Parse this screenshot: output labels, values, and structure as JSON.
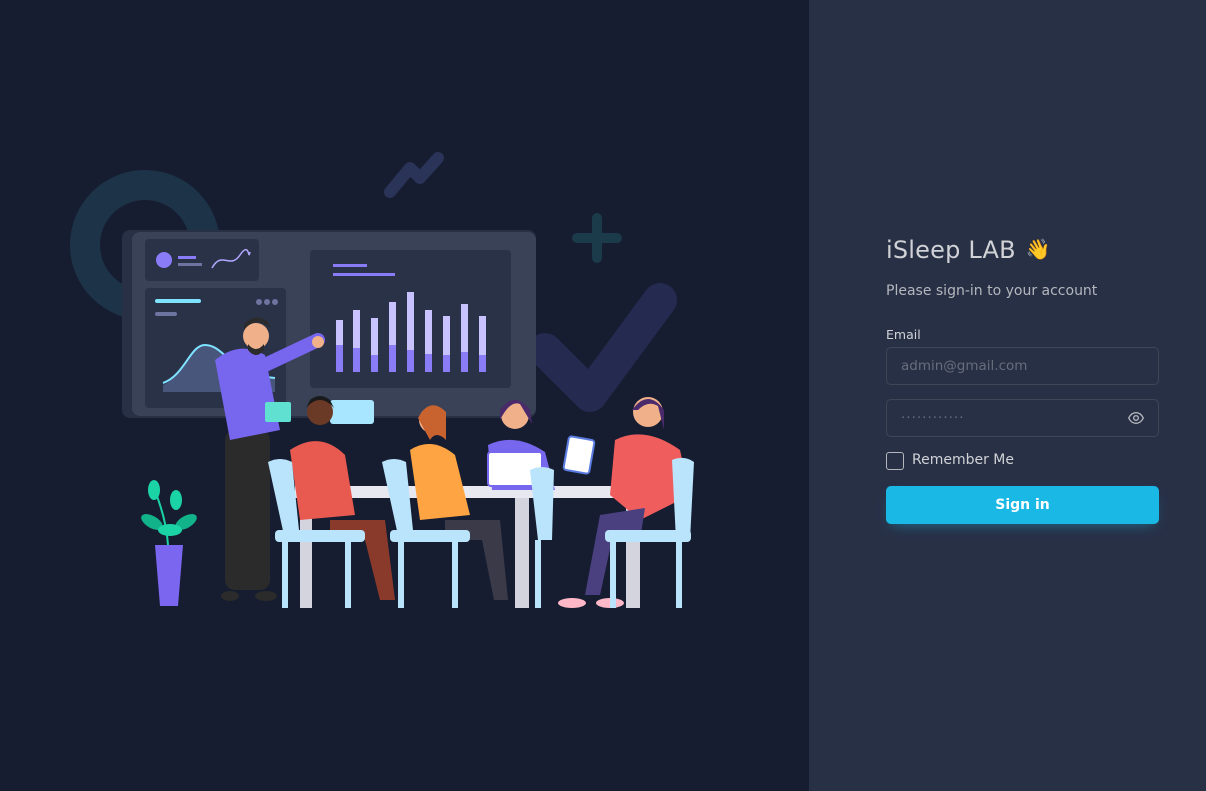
{
  "app": {
    "title": "iSleep LAB",
    "wave_emoji": "👋",
    "subtitle": "Please sign-in to your account"
  },
  "form": {
    "email_label": "Email",
    "email_placeholder": "admin@gmail.com",
    "password_value": "············",
    "remember_label": "Remember Me",
    "remember_checked": false,
    "submit_label": "Sign in"
  },
  "icons": {
    "password_toggle": "eye-icon",
    "hand": "waving-hand-icon"
  },
  "colors": {
    "left_bg": "#161d31",
    "right_bg": "#283046",
    "accent": "#1ab8e4",
    "text": "#d0d2d6"
  }
}
